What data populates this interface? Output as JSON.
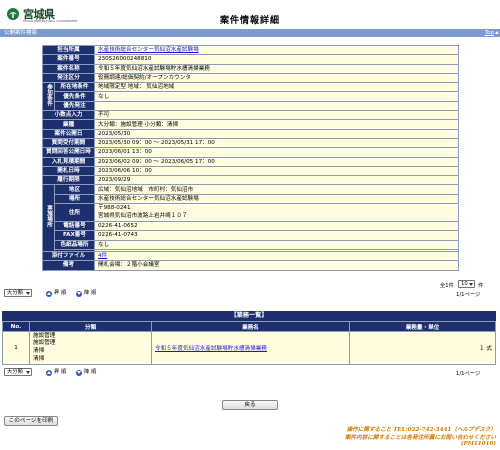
{
  "header": {
    "logo_text": "宮城県",
    "logo_sub": "MIYAGI PREFECTURAL GOVERNMENT",
    "title": "案件情報詳細"
  },
  "section_bar": {
    "left": "公開案件検索",
    "right": "Top"
  },
  "detail": {
    "rows": {
      "dept": {
        "label": "担当所属",
        "value": "水産技術総合センター気仙沼水産試験場"
      },
      "case_no": {
        "label": "案件番号",
        "value": "230526000248810"
      },
      "case_name": {
        "label": "案件名称",
        "value": "令和５年度気仙沼水産試験場貯水槽清掃業務"
      },
      "category": {
        "label": "発注区分",
        "value": "役務調達/総価契約/オープンカウンタ"
      },
      "grp_label": "参加条件",
      "location": {
        "label": "所在地条件",
        "value": "地域限定型 地域： 気仙沼地域"
      },
      "priority": {
        "label": "優先条件",
        "value": "なし"
      },
      "preferred": {
        "label": "優先発注",
        "value": ""
      },
      "split": {
        "label": "小数点入力",
        "value": "不可"
      },
      "industry": {
        "label": "業種",
        "value": "大分類：施設管理 小分類：清掃"
      },
      "pub_date": {
        "label": "案件公開日",
        "value": "2023/05/30"
      },
      "q_period": {
        "label": "質問受付期間",
        "value": "2023/05/30 09：00 ～ 2023/05/31 17：00"
      },
      "q_answer": {
        "label": "質問回答公開日時",
        "value": "2023/06/01 13：00"
      },
      "bid_period": {
        "label": "入札見積期間",
        "value": "2023/06/02 09：00 ～ 2023/06/05 17：00"
      },
      "open_date": {
        "label": "開札日時",
        "value": "2023/06/06 10：00"
      },
      "perform": {
        "label": "履行期限",
        "value": "2023/09/29"
      },
      "grp2_label": "実施場所",
      "area": {
        "label": "地区",
        "value": "広域：気仙沼地域　市町村：気仙沼市"
      },
      "place": {
        "label": "場所",
        "value": "水産技術総合センター気仙沼水産試験場"
      },
      "address": {
        "label": "住所",
        "line1": "〒988-0241",
        "line2": "宮城県気仙沼市波路上岩井崎１０７"
      },
      "tel": {
        "label": "電話番号",
        "value": "0226-41-0652"
      },
      "fax": {
        "label": "FAX番号",
        "value": "0226-41-0743"
      },
      "other": {
        "label": "色紙品場所",
        "value": "なし"
      },
      "attach": {
        "label": "添付ファイル",
        "value": "4件"
      },
      "remarks": {
        "label": "備考",
        "value": "開札会場：２階小会議室"
      }
    }
  },
  "controls": {
    "size_select": "大分類",
    "asc": "昇 順",
    "desc": "降 順",
    "count_prefix": "全1件",
    "per_page": "10",
    "count_suffix": "件",
    "page_info": "1/1ページ"
  },
  "list": {
    "title": "【業務一覧】",
    "columns": [
      "No.",
      "分類",
      "業務名",
      "業務量・単位"
    ],
    "rows": [
      {
        "no": "1",
        "categories": [
          "施設管理",
          "施設管理",
          "清掃",
          "清掃"
        ],
        "name": "令和５年度気仙沼水産試験場貯水槽清掃業務",
        "qty": "１ 式"
      }
    ]
  },
  "buttons": {
    "back": "戻る",
    "print": "このページを印刷"
  },
  "footer": {
    "line1": "操作に関すること TEL:022-742-3441（ヘルプデスク）",
    "line2": "案件内容に関することは各発注所属にお問い合わせください",
    "code": "(PM11010)"
  },
  "colors": {
    "label_bg": "#1e2f70",
    "value_bg": "#fffce0",
    "bar_bg": "#7b9bd0",
    "footer_text": "#d27a00"
  }
}
